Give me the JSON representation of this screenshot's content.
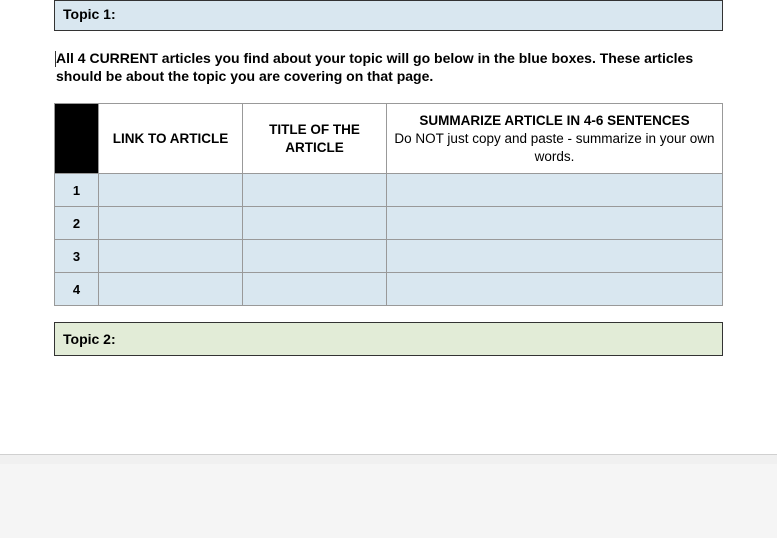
{
  "topic1": {
    "label": "Topic 1:"
  },
  "instruction": "All 4 CURRENT articles you find about your topic will go below in the blue boxes. These articles should be about the topic you are covering on that page.",
  "table": {
    "headers": {
      "link": "LINK TO ARTICLE",
      "title": "TITLE OF THE ARTICLE",
      "summary_bold": "SUMMARIZE ARTICLE IN 4-6 SENTENCES",
      "summary_sub": "Do NOT just copy and paste - summarize in your own words."
    },
    "rows": [
      {
        "num": "1",
        "link": "",
        "title": "",
        "summary": ""
      },
      {
        "num": "2",
        "link": "",
        "title": "",
        "summary": ""
      },
      {
        "num": "3",
        "link": "",
        "title": "",
        "summary": ""
      },
      {
        "num": "4",
        "link": "",
        "title": "",
        "summary": ""
      }
    ]
  },
  "topic2": {
    "label": "Topic 2:"
  }
}
